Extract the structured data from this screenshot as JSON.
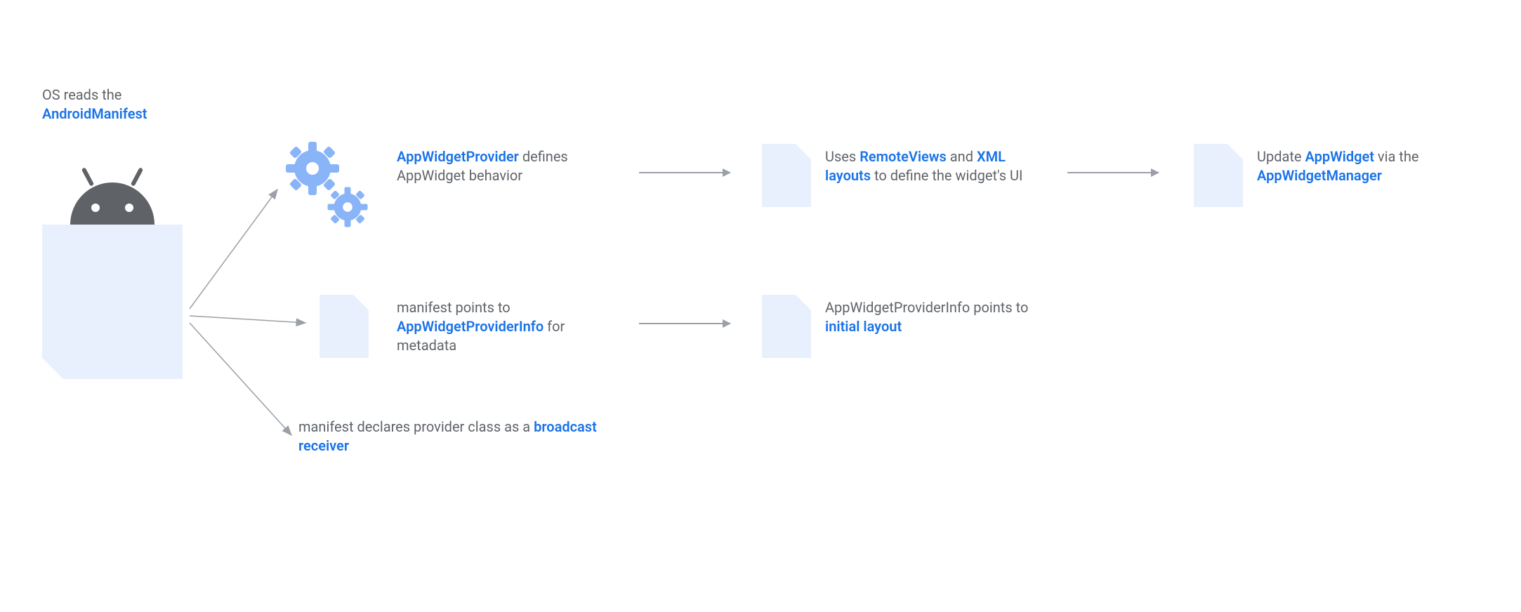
{
  "header": {
    "line1": "OS reads the",
    "line2": "AndroidManifest"
  },
  "nodes": {
    "gears": {
      "title": "AppWidgetProvider",
      "desc": "defines AppWidget behavior"
    },
    "remoteviews": {
      "pre": "Uses ",
      "key1": "RemoteViews",
      "mid": " and ",
      "key2": "XML layouts",
      "post": " to define the widget's UI"
    },
    "update": {
      "pre": "Update ",
      "key1": "AppWidget",
      "mid": " via the ",
      "key2": "AppWidgetManager"
    },
    "providerinfo": {
      "pre": "manifest points to ",
      "key": "AppWidgetProviderInfo",
      "post": " for metadata"
    },
    "initiallayout": {
      "pre": "AppWidgetProviderInfo points to ",
      "key": "initial layout"
    },
    "broadcast": {
      "pre": "manifest declares provider class as a ",
      "key": "broadcast receiver"
    }
  },
  "colors": {
    "accent": "#1a73e8",
    "lightAccent": "#8ab4f8",
    "fileFill": "#e8f0fe",
    "text": "#5f6368",
    "arrow": "#9aa0a6"
  }
}
